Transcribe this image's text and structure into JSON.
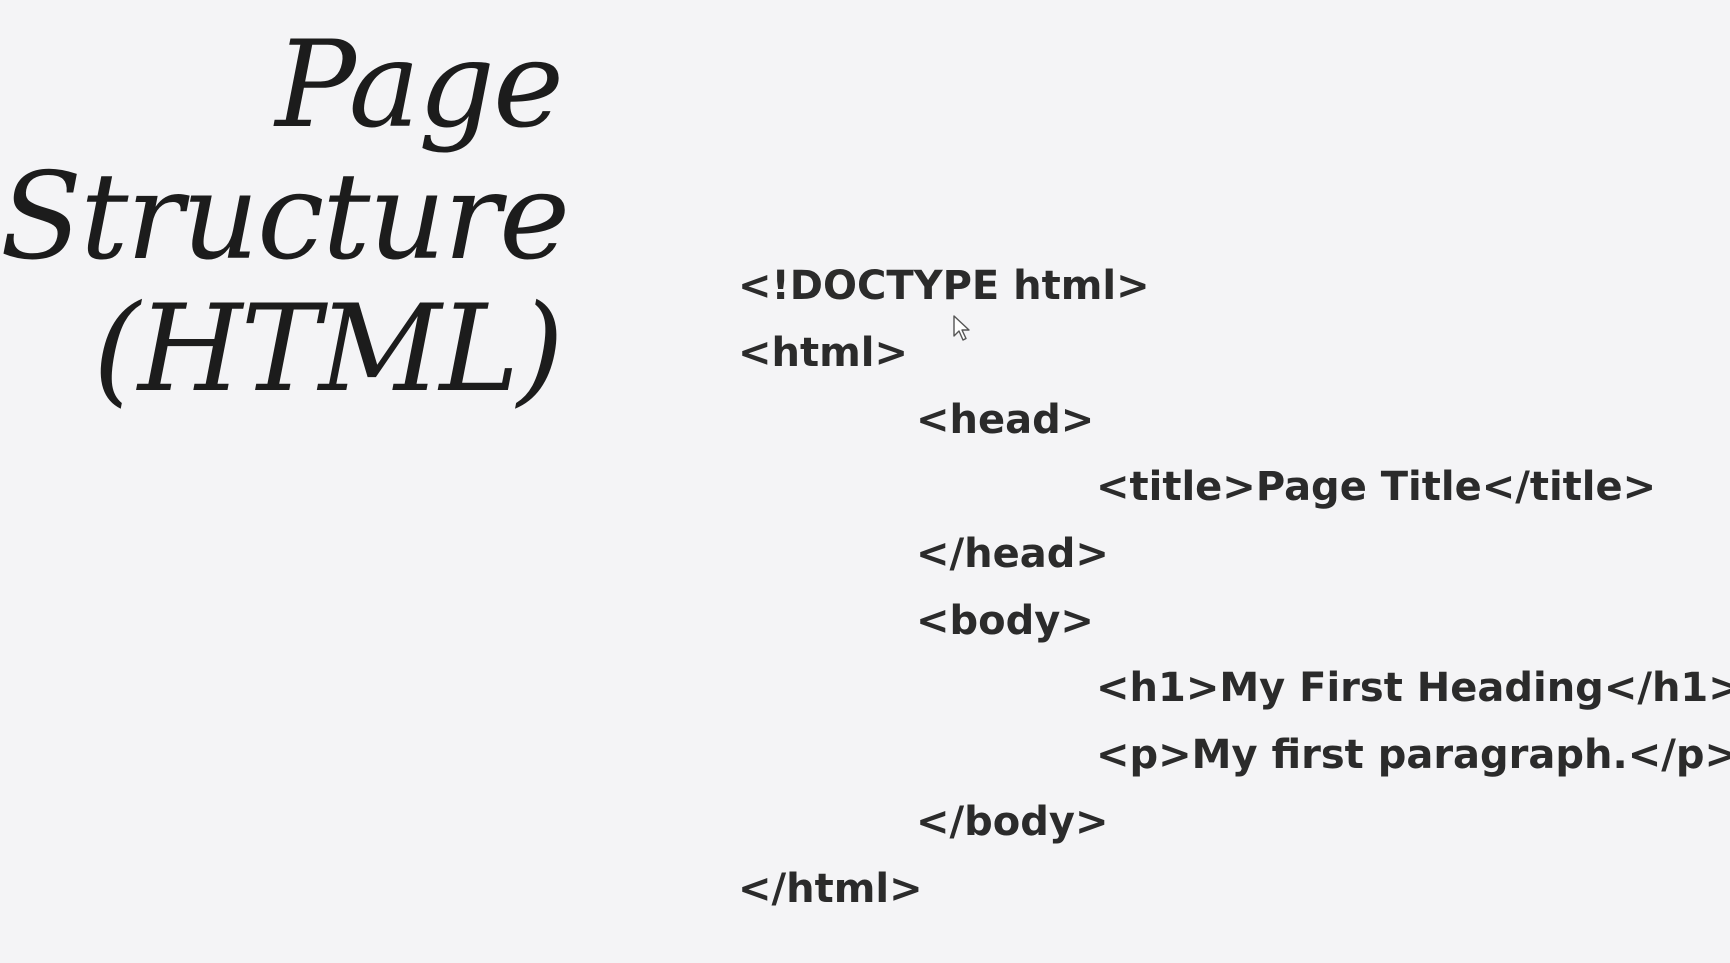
{
  "slide": {
    "title_lines": [
      "Page",
      "Structure",
      "(HTML)"
    ],
    "code_lines": [
      {
        "text": "<!DOCTYPE html>",
        "indent": 0
      },
      {
        "text": "<html>",
        "indent": 0
      },
      {
        "text": "<head>",
        "indent": 1
      },
      {
        "text": "<title>Page Title</title>",
        "indent": 2
      },
      {
        "text": "</head>",
        "indent": 1
      },
      {
        "text": "<body>",
        "indent": 1
      },
      {
        "text": "<h1>My First Heading</h1>",
        "indent": 2
      },
      {
        "text": "<p>My first paragraph.</p>",
        "indent": 2
      },
      {
        "text": "</body>",
        "indent": 1
      },
      {
        "text": "</html>",
        "indent": 0
      }
    ]
  },
  "colors": {
    "background": "#f4f4f6",
    "title_text": "#1c1c1c",
    "code_text": "#2b2b2b"
  },
  "cursor": {
    "icon": "mouse-pointer-icon"
  }
}
